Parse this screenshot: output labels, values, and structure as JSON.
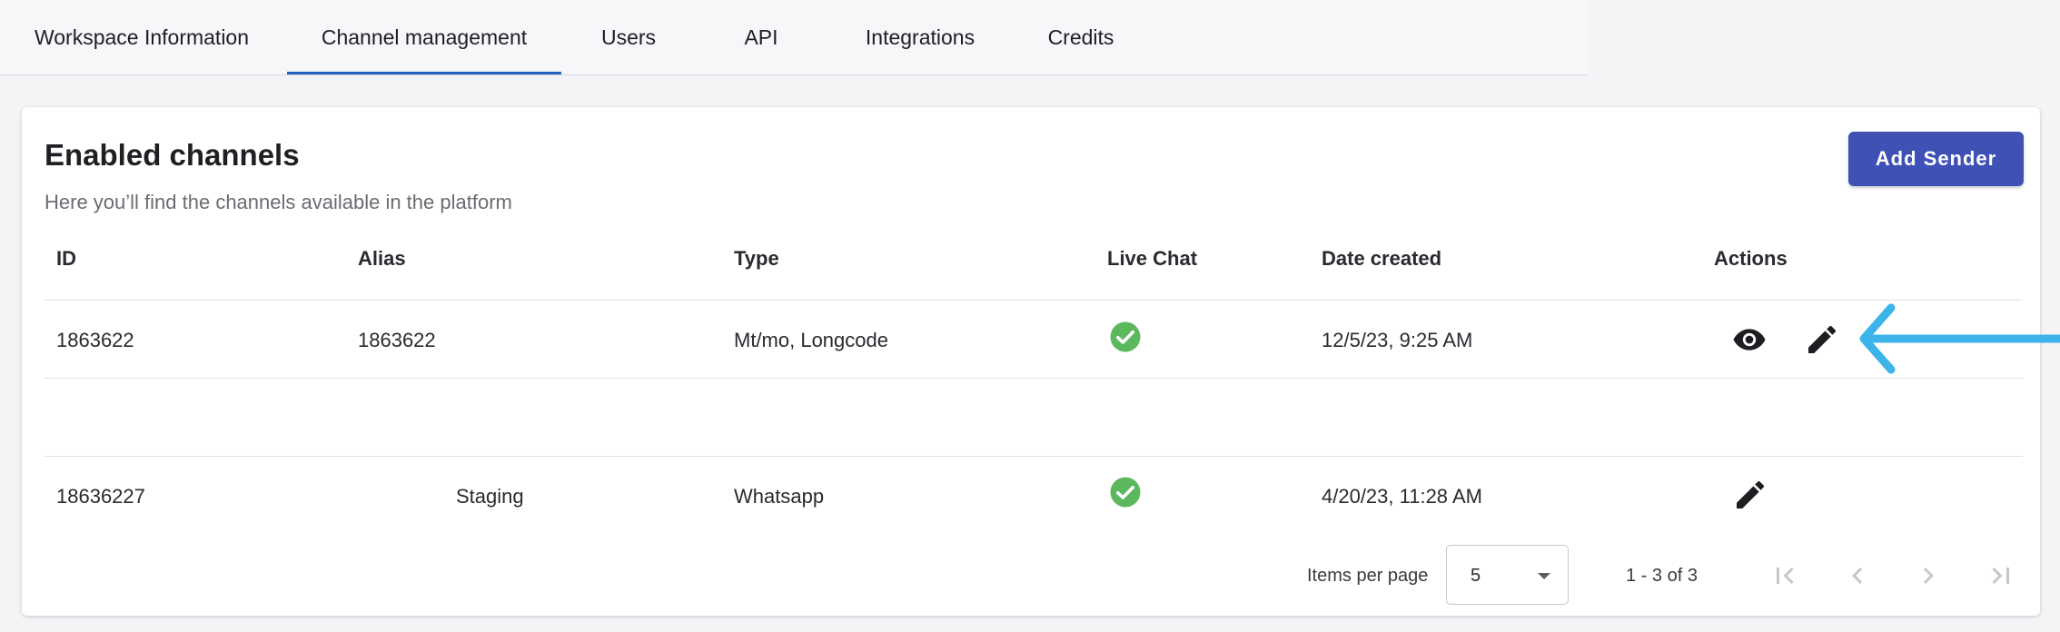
{
  "tabs": [
    {
      "label": "Workspace Information",
      "active": false
    },
    {
      "label": "Channel management",
      "active": true
    },
    {
      "label": "Users",
      "active": false
    },
    {
      "label": "API",
      "active": false
    },
    {
      "label": "Integrations",
      "active": false
    },
    {
      "label": "Credits",
      "active": false
    }
  ],
  "card": {
    "title": "Enabled channels",
    "subtitle": "Here you’ll find the channels available in the platform",
    "add_button_label": "Add Sender"
  },
  "table": {
    "headers": {
      "id": "ID",
      "alias": "Alias",
      "type": "Type",
      "live_chat": "Live Chat",
      "date_created": "Date created",
      "actions": "Actions"
    },
    "rows": [
      {
        "id": "1863622",
        "alias": "1863622",
        "type": "Mt/mo, Longcode",
        "live_chat": true,
        "date_created": "12/5/23, 9:25 AM",
        "actions": [
          "view",
          "edit"
        ]
      },
      {
        "id": "",
        "alias": "",
        "type": "",
        "live_chat": false,
        "date_created": "",
        "actions": []
      },
      {
        "id": "18636227",
        "alias": "Staging",
        "type": "Whatsapp",
        "live_chat": true,
        "date_created": "4/20/23, 11:28 AM",
        "actions": [
          "edit"
        ]
      }
    ]
  },
  "pagination": {
    "items_per_page_label": "Items per page",
    "items_per_page_value": "5",
    "range_label": "1 - 3 of 3"
  },
  "colors": {
    "accent": "#3f51b5",
    "tab_indicator": "#1f5fbf",
    "check_green": "#5cb85c",
    "annotation_arrow": "#3cb4ea"
  },
  "icons": {
    "live_chat": "check-circle-icon",
    "view": "eye-icon",
    "edit": "pencil-icon",
    "first_page": "first-page-icon",
    "prev_page": "chevron-left-icon",
    "next_page": "chevron-right-icon",
    "last_page": "last-page-icon",
    "select_caret": "caret-down-icon"
  }
}
